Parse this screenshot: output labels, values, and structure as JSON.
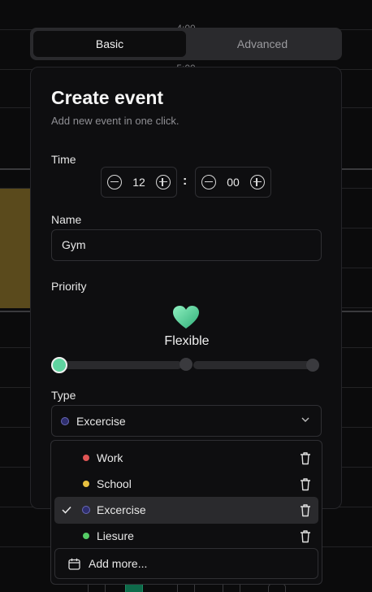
{
  "background": {
    "time_labels": [
      "4:00",
      "5:00"
    ],
    "event_color": "#5a4a1c"
  },
  "mode_tabs": {
    "basic": "Basic",
    "advanced": "Advanced",
    "active": "Basic"
  },
  "dialog": {
    "title": "Create event",
    "subtitle": "Add new event in one click.",
    "time": {
      "label": "Time",
      "hours": "12",
      "separator": ":",
      "minutes": "00"
    },
    "name": {
      "label": "Name",
      "value": "Gym"
    },
    "priority": {
      "label": "Priority",
      "icon": "green-heart-icon",
      "level_label": "Flexible",
      "level": 0
    },
    "type": {
      "label": "Type",
      "selected": "Excercise",
      "selected_color": "#2e2e6e"
    }
  },
  "type_dropdown": {
    "options": [
      {
        "label": "Work",
        "color": "#e05555"
      },
      {
        "label": "School",
        "color": "#e8c040"
      },
      {
        "label": "Excercise",
        "color": "#2e2e6e",
        "selected": true
      },
      {
        "label": "Liesure",
        "color": "#55cc66"
      }
    ],
    "add_more": "Add more..."
  },
  "colors": {
    "accent": "#5fd3a0",
    "surface": "#0e0e10",
    "border": "#2f2f33"
  }
}
